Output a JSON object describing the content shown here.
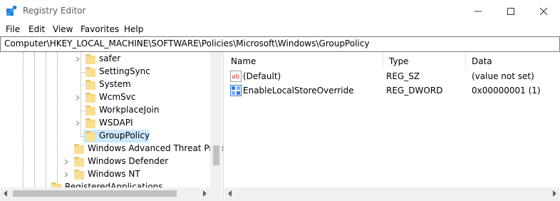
{
  "window": {
    "title": "Registry Editor",
    "controls": {
      "minimize": "minimize",
      "maximize": "maximize",
      "close": "close"
    }
  },
  "menu": {
    "items": [
      "File",
      "Edit",
      "View",
      "Favorites",
      "Help"
    ]
  },
  "address": {
    "path": "Computer\\HKEY_LOCAL_MACHINE\\SOFTWARE\\Policies\\Microsoft\\Windows\\GroupPolicy"
  },
  "tree": {
    "nodes": [
      {
        "label": "safer",
        "expandable": true,
        "selected": false
      },
      {
        "label": "SettingSync",
        "expandable": false,
        "selected": false
      },
      {
        "label": "System",
        "expandable": false,
        "selected": false
      },
      {
        "label": "WcmSvc",
        "expandable": true,
        "selected": false
      },
      {
        "label": "WorkplaceJoin",
        "expandable": false,
        "selected": false
      },
      {
        "label": "WSDAPI",
        "expandable": true,
        "selected": false
      },
      {
        "label": "GroupPolicy",
        "expandable": false,
        "selected": true
      },
      {
        "label": "Windows Advanced Threat Prote",
        "expandable": false,
        "selected": false
      },
      {
        "label": "Windows Defender",
        "expandable": true,
        "selected": false
      },
      {
        "label": "Windows NT",
        "expandable": true,
        "selected": false
      },
      {
        "label": "RegisteredApplications",
        "expandable": false,
        "selected": false
      }
    ]
  },
  "list": {
    "columns": {
      "name": "Name",
      "type": "Type",
      "data": "Data"
    },
    "rows": [
      {
        "icon": "string-value-icon",
        "name": "(Default)",
        "type": "REG_SZ",
        "data": "(value not set)"
      },
      {
        "icon": "binary-value-icon",
        "name": "EnableLocalStoreOverride",
        "type": "REG_DWORD",
        "data": "0x00000001 (1)"
      }
    ]
  },
  "colors": {
    "selection": "#cce8ff",
    "folder": "#f5d787",
    "scrollbar": "#f0f0f0"
  }
}
